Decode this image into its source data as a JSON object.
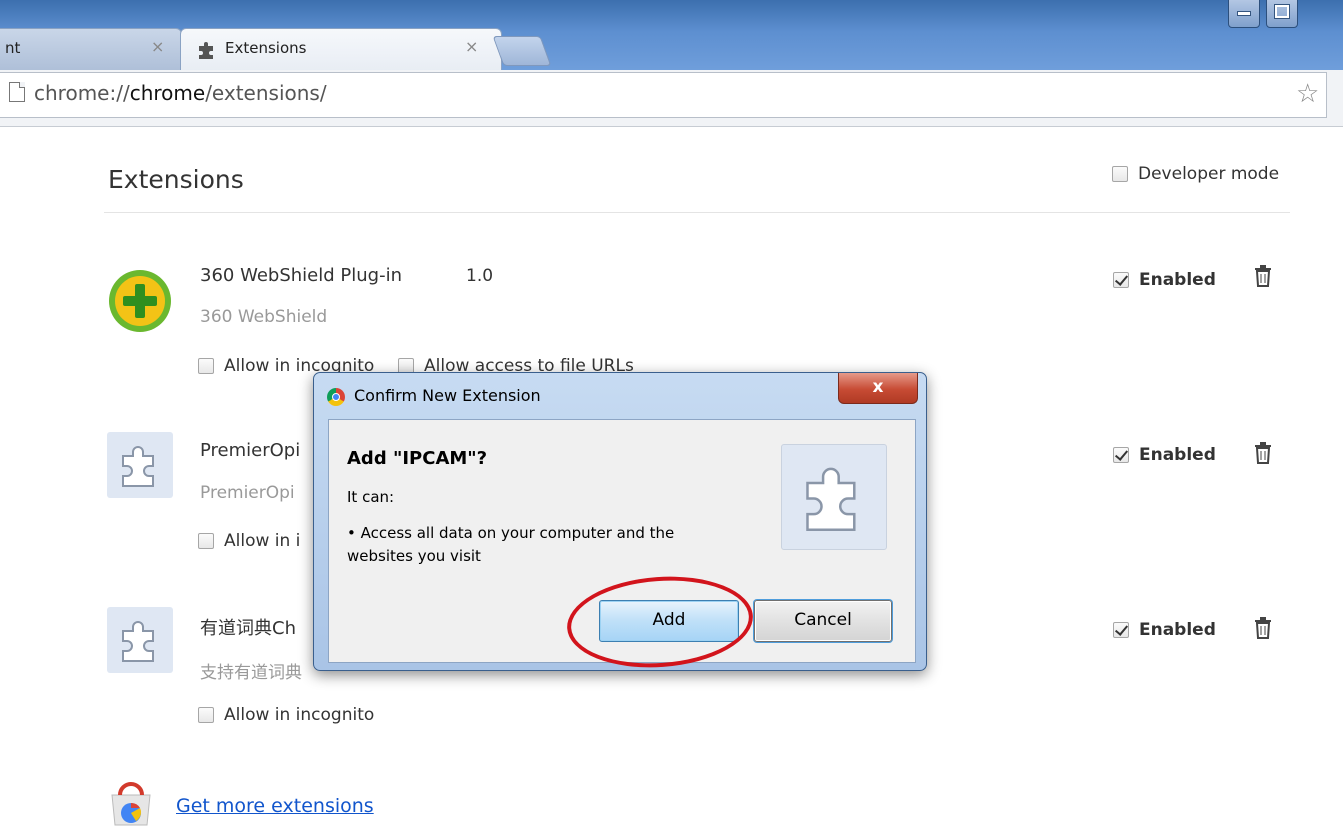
{
  "browser": {
    "tabs": [
      {
        "label": "nt",
        "active": false
      },
      {
        "label": "Extensions",
        "active": true
      }
    ],
    "url": {
      "prefix": "chrome://",
      "bold": "chrome",
      "suffix": "/extensions/"
    }
  },
  "page": {
    "title": "Extensions",
    "developer_mode_label": "Developer mode",
    "extensions": [
      {
        "name": "360 WebShield Plug-in",
        "version": "1.0",
        "description": "360 WebShield",
        "options": [
          "Allow in incognito",
          "Allow access to file URLs"
        ],
        "enabled_label": "Enabled"
      },
      {
        "name": "PremierOpi",
        "version": "",
        "description": "PremierOpi",
        "options": [
          "Allow in i"
        ],
        "enabled_label": "Enabled"
      },
      {
        "name": "有道词典Ch",
        "version": "",
        "description": "支持有道词典",
        "options": [
          "Allow in incognito"
        ],
        "enabled_label": "Enabled"
      }
    ],
    "get_more_label": "Get more extensions"
  },
  "dialog": {
    "title": "Confirm New Extension",
    "close_label": "x",
    "heading": "Add \"IPCAM\"?",
    "it_can": "It can:",
    "permission_line1": "• Access all data on your computer and the",
    "permission_line2": "websites you visit",
    "add_label": "Add",
    "cancel_label": "Cancel"
  },
  "colors": {
    "link": "#1155cc",
    "highlight_circle": "#d2141c",
    "title_bar": "#5d8fd0"
  }
}
